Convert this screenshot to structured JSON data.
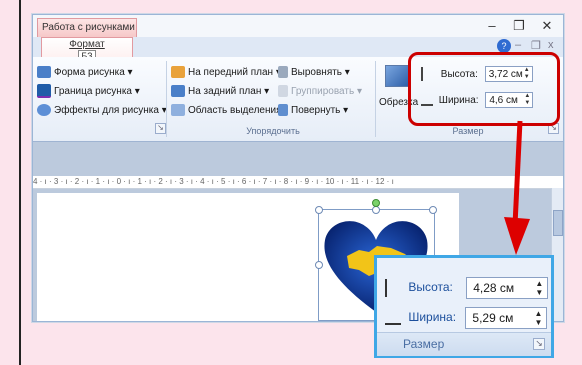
{
  "window": {
    "context_tab": "Работа с рисунками",
    "format_tab": "Формат",
    "format_key": "БЗ",
    "controls": {
      "minimize": "–",
      "maximize": "❐",
      "close": "✕"
    },
    "tab_controls": {
      "help": "?",
      "min": "–",
      "restore": "❐",
      "close": "x"
    }
  },
  "ribbon": {
    "styles_group": {
      "items": [
        "Форма рисунка ▾",
        "Граница рисунка ▾",
        "Эффекты для рисунка ▾"
      ]
    },
    "arrange_group": {
      "label": "Упорядочить",
      "items_left": [
        "На передний план ▾",
        "На задний план ▾",
        "Область выделения"
      ],
      "items_right": [
        "Выровнять ▾",
        "Группировать ▾",
        "Повернуть ▾"
      ]
    },
    "size_group": {
      "label": "Размер",
      "crop": "Обрезка",
      "height_label": "Высота:",
      "height_value": "3,72 см",
      "width_label": "Ширина:",
      "width_value": "4,6 см"
    }
  },
  "ruler": "4 · ı · 3 · ı · 2 · ı · 1 · ı · 0 · ı · 1 · ı · 2 · ı · 3 · ı · 4 · ı · 5 · ı · 6 · ı · 7 · ı · 8 · ı · 9 · ı · 10 · ı · 11 · ı · 12 · ı",
  "callout": {
    "height_label": "Высота:",
    "height_value": "4,28 см",
    "width_label": "Ширина:",
    "width_value": "5,29 см",
    "group_label": "Размер"
  },
  "colors": {
    "highlight_red": "#cc0000",
    "callout_border": "#3fa7e6",
    "heart_blue": "#0b3aa8",
    "map_yellow": "#f2c418"
  }
}
